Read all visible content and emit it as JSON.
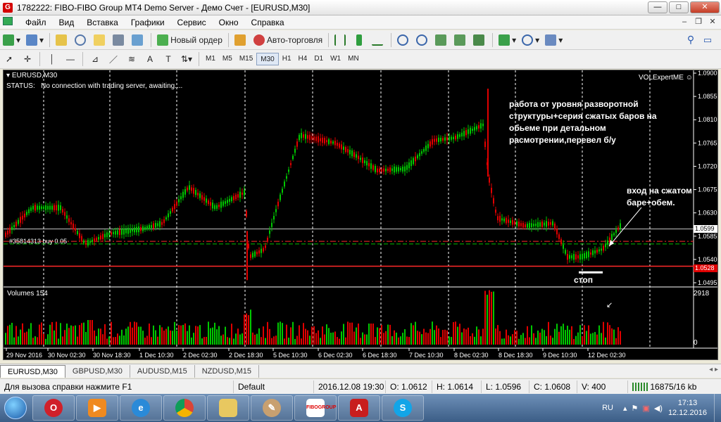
{
  "window": {
    "title": "1782222: FIBO-FIBO Group MT4 Demo Server - Демо Счет - [EURUSD,M30]",
    "min": "—",
    "max": "□",
    "close": "✕"
  },
  "menu": [
    "Файл",
    "Вид",
    "Вставка",
    "Графики",
    "Сервис",
    "Окно",
    "Справка"
  ],
  "toolbar": {
    "new_order": "Новый ордер",
    "autotrading": "Авто-торговля"
  },
  "timeframes": [
    "M1",
    "M5",
    "M15",
    "M30",
    "H1",
    "H4",
    "D1",
    "W1",
    "MN"
  ],
  "active_timeframe": "M30",
  "chart": {
    "symbol_label": "EURUSD,M30",
    "status_label": "STATUS:",
    "status_text": "No connection with trading server, awaiting....",
    "expert": "VOLExpertME",
    "order_label": "#35814313 buy 0.05",
    "price_scale": [
      "1.0900",
      "1.0855",
      "1.0810",
      "1.0765",
      "1.0720",
      "1.0675",
      "1.0630",
      "1.0585",
      "1.0540",
      "1.0495"
    ],
    "current_price": "1.0599",
    "sl_price": "1.0528",
    "volumes_label": "Volumes 154",
    "volume_max": "2918",
    "volume_min": "0",
    "time_labels": [
      "29 Nov 2016",
      "30 Nov 02:30",
      "30 Nov 18:30",
      "1 Dec 10:30",
      "2 Dec 02:30",
      "2 Dec 18:30",
      "5 Dec 10:30",
      "6 Dec 02:30",
      "6 Dec 18:30",
      "7 Dec 10:30",
      "8 Dec 02:30",
      "8 Dec 18:30",
      "9 Dec 10:30",
      "12 Dec 02:30"
    ],
    "annotation_1": [
      "работа от уровня разворотной",
      "структуры+серия сжатых баров на",
      "обьеме при детальном",
      "расмотрении,перевел б/у"
    ],
    "annotation_2": [
      "вход на сжатом",
      "баре+обем."
    ],
    "annotation_stop": "стоп",
    "colors": {
      "bull": "#00c800",
      "bear": "#e00000",
      "level": "#ff2a2a",
      "grid": "#ffffff"
    }
  },
  "tabs": [
    "EURUSD,M30",
    "GBPUSD,M30",
    "AUDUSD,M15",
    "NZDUSD,M15"
  ],
  "status": {
    "help": "Для вызова справки нажмите F1",
    "profile": "Default",
    "time": "2016.12.08 19:30",
    "open": "O: 1.0612",
    "high": "H: 1.0614",
    "low": "L: 1.0596",
    "close": "C: 1.0608",
    "volume": "V: 400",
    "traffic": "16875/16 kb"
  },
  "taskbar": {
    "apps": [
      "opera-icon",
      "media-player-icon",
      "ie-icon",
      "chrome-icon",
      "folder-icon",
      "paint-icon",
      "fibogroup-icon",
      "pdf-icon",
      "skype-icon"
    ],
    "fibo_label": "FIBOGROUP",
    "lang": "RU",
    "time": "17:13",
    "date": "12.12.2016"
  }
}
